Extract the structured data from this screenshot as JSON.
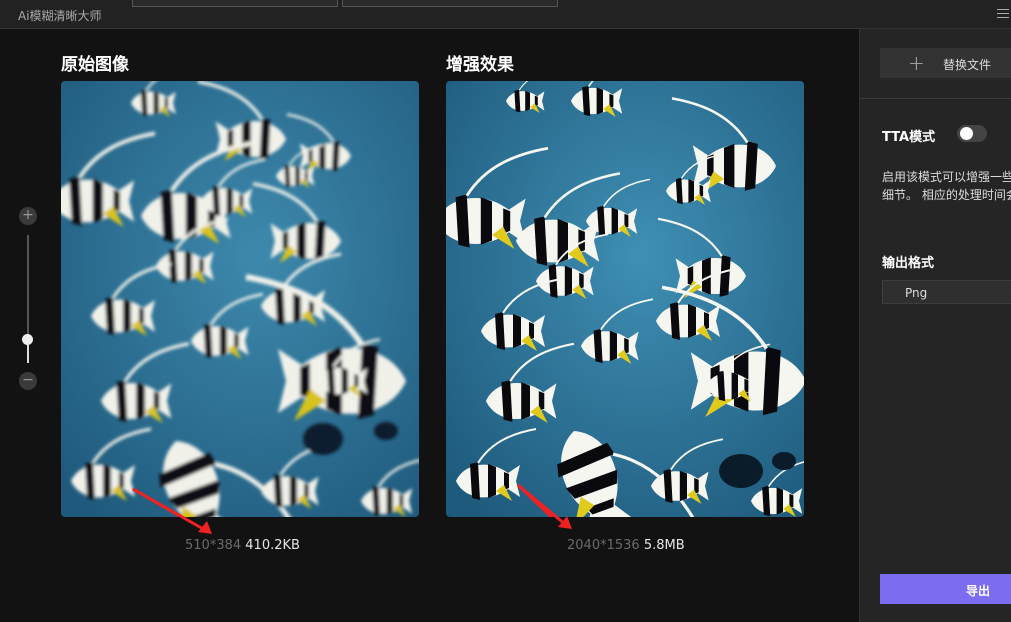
{
  "window": {
    "title": "Ai模糊清晰大师"
  },
  "left_panel": {
    "title": "原始图像",
    "dims": "510*384",
    "size": "410.2KB"
  },
  "right_panel": {
    "title": "增强效果",
    "dims": "2040*1536",
    "size": "5.8MB"
  },
  "zoom": {
    "plus": "+",
    "minus": "−",
    "level": 0.18
  },
  "sidebar": {
    "replace_button": "替换文件",
    "tta_label": "TTA模式",
    "tta_enabled": false,
    "tta_desc_line1": "启用该模式可以增强一些",
    "tta_desc_line2": "细节。 相应的处理时间会",
    "format_label": "输出格式",
    "format_value": "Png",
    "export_button": "导出"
  },
  "colors": {
    "accent": "#7c6cf0",
    "annotation_arrow": "#ee2222",
    "water": "#2b6f93"
  }
}
